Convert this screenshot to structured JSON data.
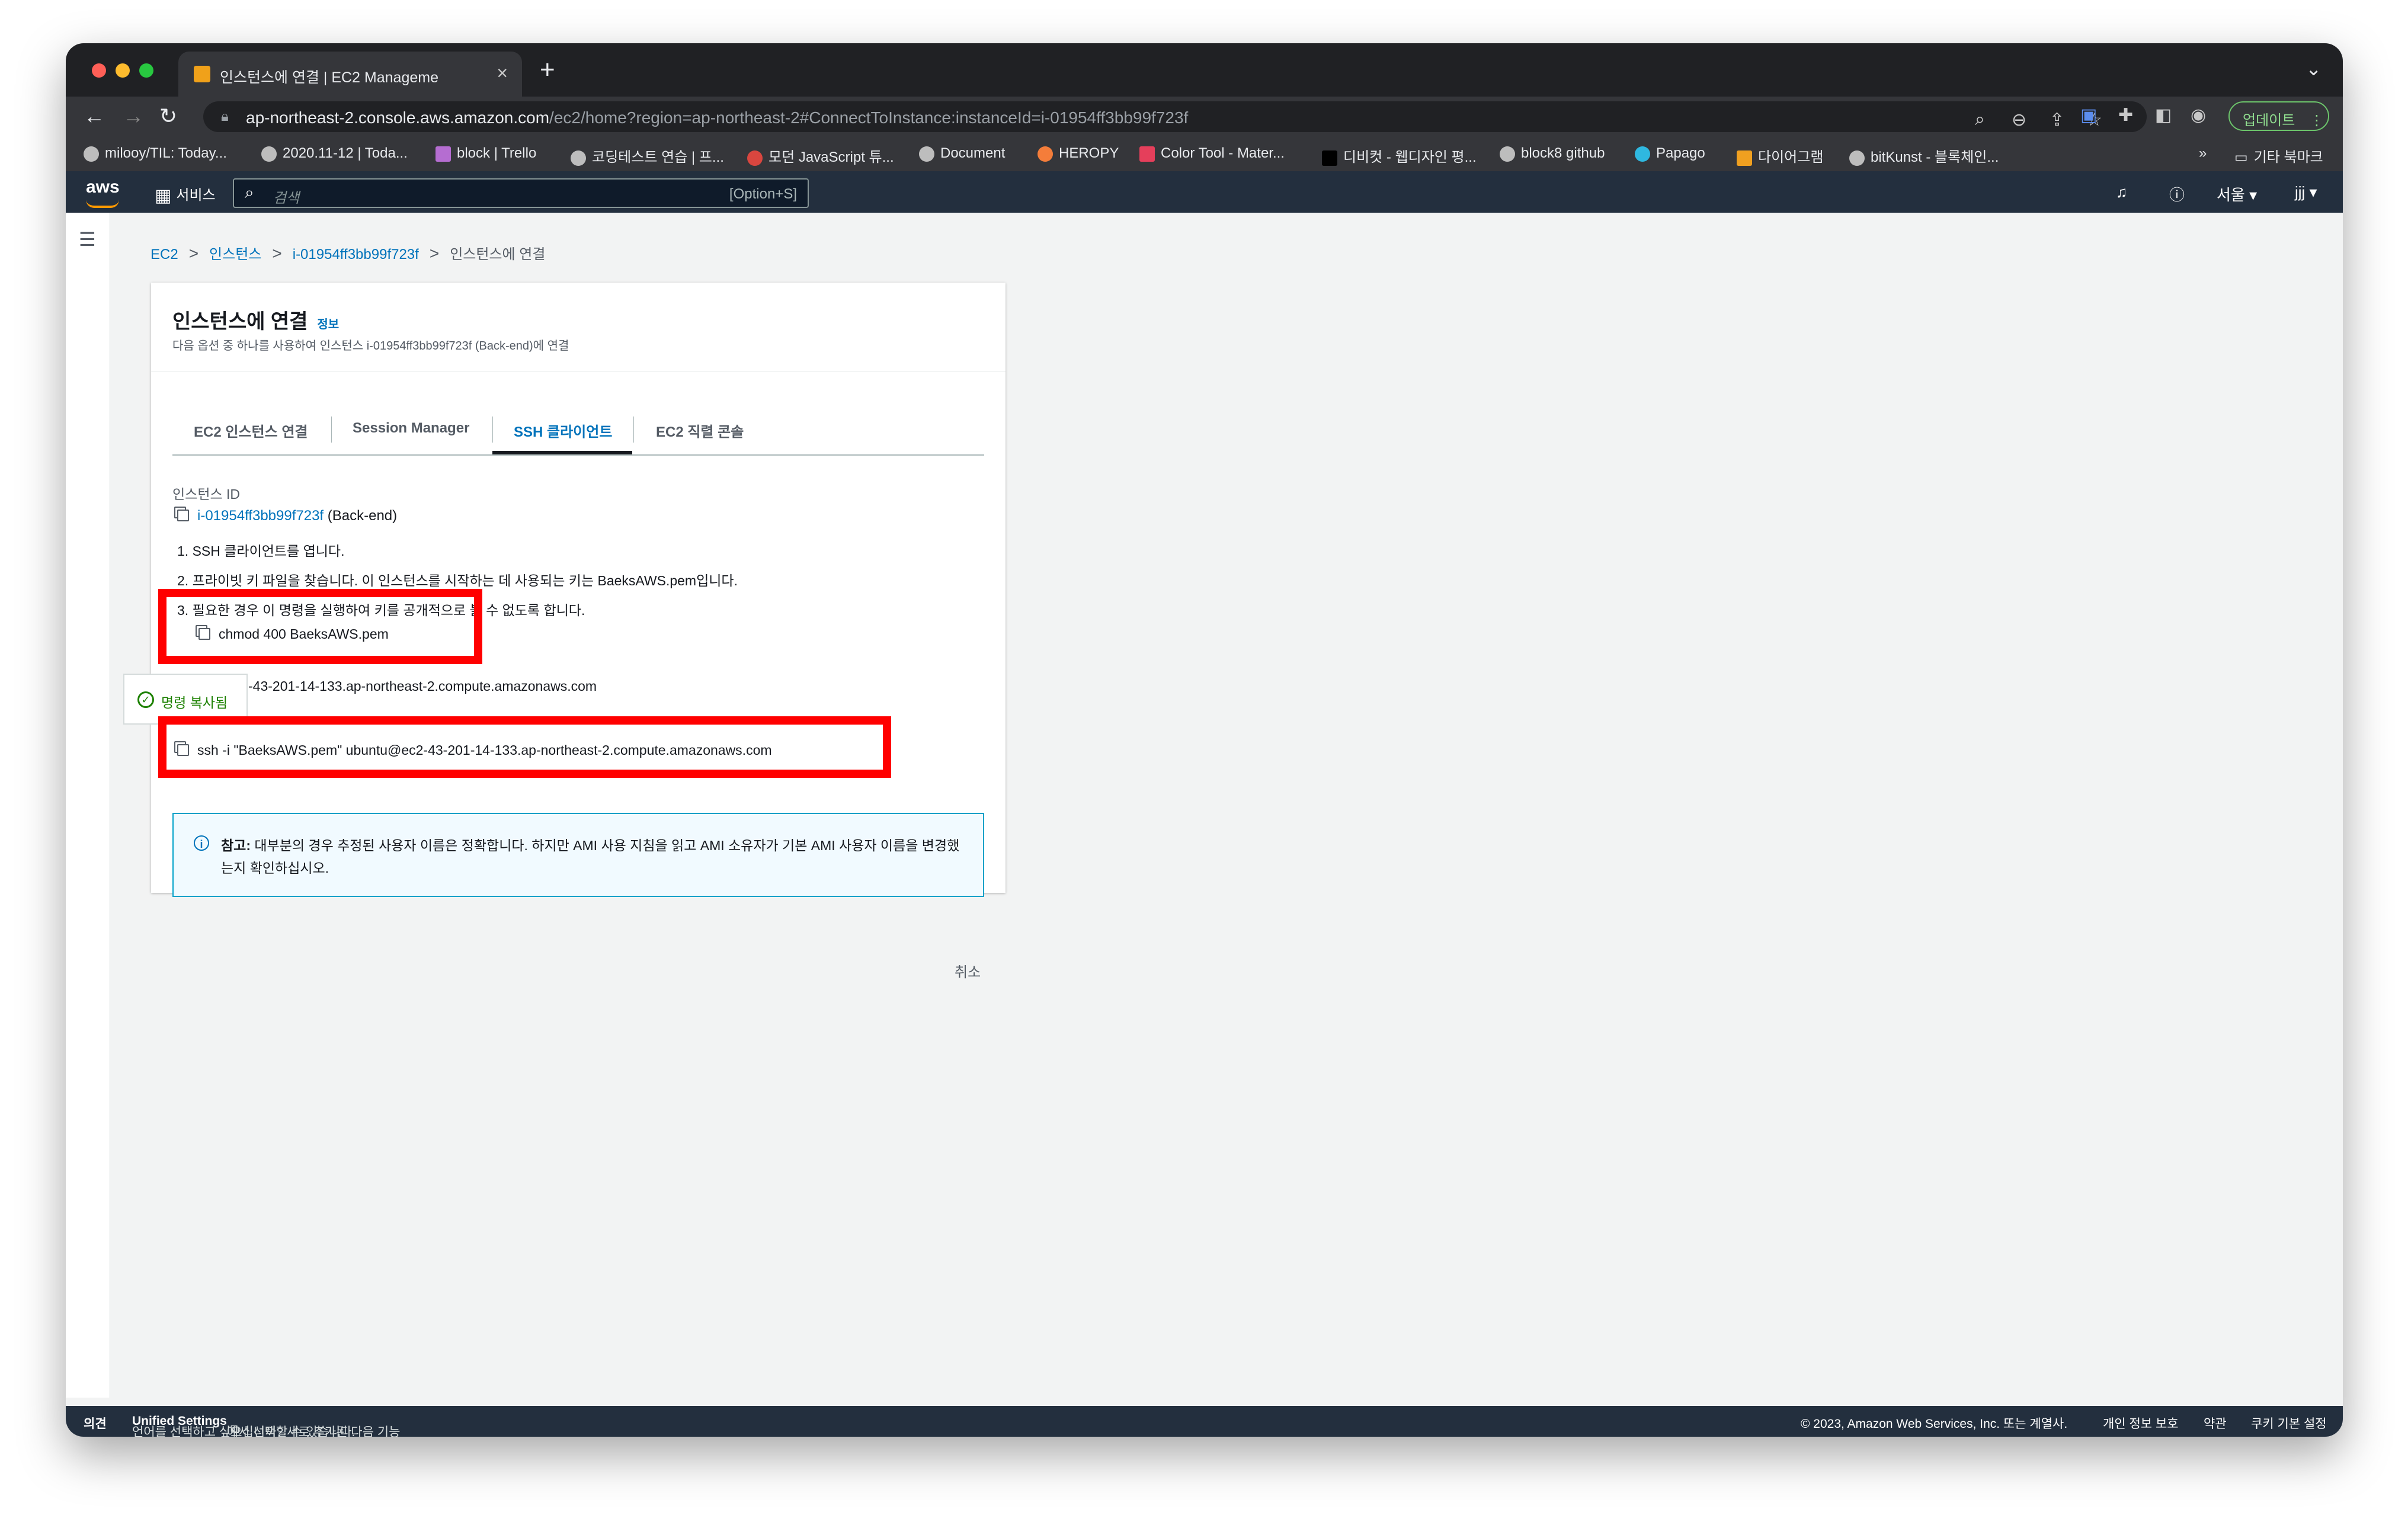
{
  "browser": {
    "tab_title": "인스턴스에 연결 | EC2 Manageme",
    "tab_close": "×",
    "new_tab": "+",
    "tab_menu": "⌄",
    "url_host": "ap-northeast-2.console.aws.amazon.com",
    "url_path": "/ec2/home?region=ap-northeast-2#ConnectToInstance:instanceId=i-01954ff3bb99f723f",
    "update_label": "업데이트",
    "bookmarks": [
      "milooy/TIL: Today...",
      "2020.11-12 | Toda...",
      "block | Trello",
      "코딩테스트 연습 | 프...",
      "모던 JavaScript 튜...",
      "Document",
      "HEROPY",
      "Color Tool - Mater...",
      "디비컷 - 웹디자인 평...",
      "block8 github",
      "Papago",
      "다이어그램",
      "bitKunst - 블록체인..."
    ],
    "bookmarks_more": "»",
    "bookmarks_other": "기타 북마크"
  },
  "aws_nav": {
    "logo": "aws",
    "services": "서비스",
    "search_placeholder": "검색",
    "search_shortcut": "[Option+S]",
    "region": "서울 ▾",
    "user": "jjj ▾"
  },
  "breadcrumb": {
    "items": [
      "EC2",
      "인스턴스",
      "i-01954ff3bb99f723f"
    ],
    "current": "인스턴스에 연결",
    "separator": ">"
  },
  "panel": {
    "title": "인스턴스에 연결",
    "info": "정보",
    "description": "다음 옵션 중 하나를 사용하여 인스턴스 i-01954ff3bb99f723f (Back-end)에 연결",
    "tabs": [
      "EC2 인스턴스 연결",
      "Session Manager",
      "SSH 클라이언트",
      "EC2 직렬 콘솔"
    ],
    "active_tab": "SSH 클라이언트",
    "instance_id_label": "인스턴스 ID",
    "instance_id": "i-01954ff3bb99f723f",
    "instance_name": "(Back-end)",
    "step1": "1. SSH 클라이언트를 엽니다.",
    "step2": "2. 프라이빗 키 파일을 찾습니다. 이 인스턴스를 시작하는 데 사용되는 키는 BaeksAWS.pem입니다.",
    "step3_visible_end": "볼 수 없도록 합니다.",
    "step3_start": "3. 필요한 경우 이 명령을 실행하여 키를 공개적으로",
    "chmod_cmd": "chmod 400 BaeksAWS.pem",
    "dns_partial": "-43-201-14-133.ap-northeast-2.compute.amazonaws.com",
    "ssh_cmd": "ssh -i \"BaeksAWS.pem\" ubuntu@ec2-43-201-14-133.ap-northeast-2.compute.amazonaws.com",
    "note_bold": "참고:",
    "note_text": " 대부분의 경우 추정된 사용자 이름은 정확합니다. 하지만 AMI 사용 지침을 읽고 AMI 소유자가 기본 AMI 사용자 이름을 변경했는지 확인하십시오.",
    "toast": "명령 복사됨",
    "cancel": "취소"
  },
  "footer": {
    "feedback": "의견",
    "language_msg": "언어를 선택하고 싶으십니까? 새로 추가된 다음 기능",
    "unified_settings": "Unified Settings",
    "language_msg_end": "에서 선택할 수 있습니다.",
    "copyright": "© 2023, Amazon Web Services, Inc. 또는 계열사.",
    "privacy": "개인 정보 보호",
    "terms": "약관",
    "cookies": "쿠키 기본 설정"
  },
  "colors": {
    "highlight": "#ff0000",
    "link": "#0073bb",
    "aws_nav": "#232f3e",
    "success": "#1d8102"
  }
}
